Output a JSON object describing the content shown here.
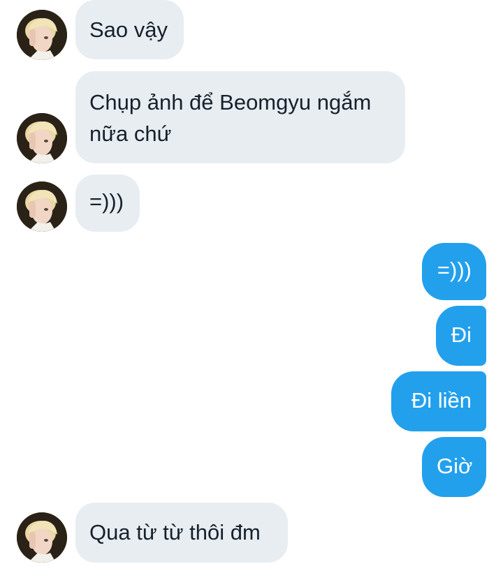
{
  "colors": {
    "incoming_bubble": "#e8edf2",
    "outgoing_bubble": "#22a0ec",
    "incoming_text": "#17212b",
    "outgoing_text": "#ffffff"
  },
  "messages": [
    {
      "direction": "incoming",
      "text": "Sao vậy"
    },
    {
      "direction": "incoming",
      "text": "Chụp ảnh để Beomgyu ngắm nữa chứ"
    },
    {
      "direction": "incoming",
      "text": "=)))"
    },
    {
      "direction": "outgoing",
      "text": "=)))"
    },
    {
      "direction": "outgoing",
      "text": "Đi"
    },
    {
      "direction": "outgoing",
      "text": "Đi liền"
    },
    {
      "direction": "outgoing",
      "text": "Giờ"
    },
    {
      "direction": "incoming",
      "text": "Qua từ từ thôi đm"
    }
  ]
}
